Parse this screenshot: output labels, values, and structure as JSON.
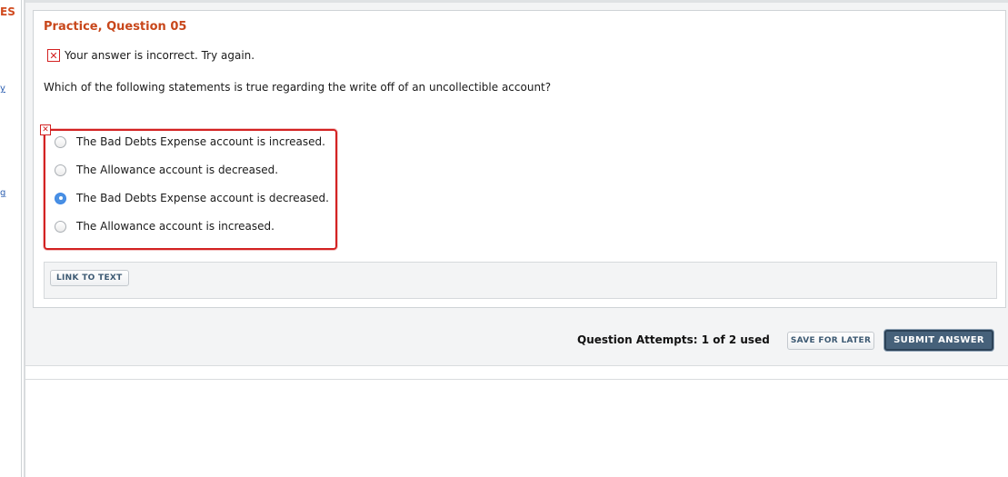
{
  "sidebar": {
    "fragment_text": "ES",
    "mark_1": "y",
    "mark_2": "g"
  },
  "question": {
    "title": "Practice, Question 05",
    "feedback_icon": "incorrect-x-icon",
    "feedback_text": "Your answer is incorrect.  Try again.",
    "prompt": "Which of the following statements is true regarding the write off of an uncollectible account?",
    "choices": [
      {
        "label": "The Bad Debts Expense account is increased.",
        "selected": false
      },
      {
        "label": "The Allowance account is decreased.",
        "selected": false
      },
      {
        "label": "The Bad Debts Expense account is decreased.",
        "selected": true
      },
      {
        "label": "The Allowance account is increased.",
        "selected": false
      }
    ],
    "link_to_text_label": "LINK TO TEXT"
  },
  "footer": {
    "attempts_text": "Question Attempts: 1 of 2 used",
    "save_label": "SAVE FOR LATER",
    "submit_label": "SUBMIT ANSWER"
  },
  "colors": {
    "title": "#c8471b",
    "error": "#d32222",
    "submit_bg": "#46617a",
    "radio_selected": "#4a90e2"
  }
}
